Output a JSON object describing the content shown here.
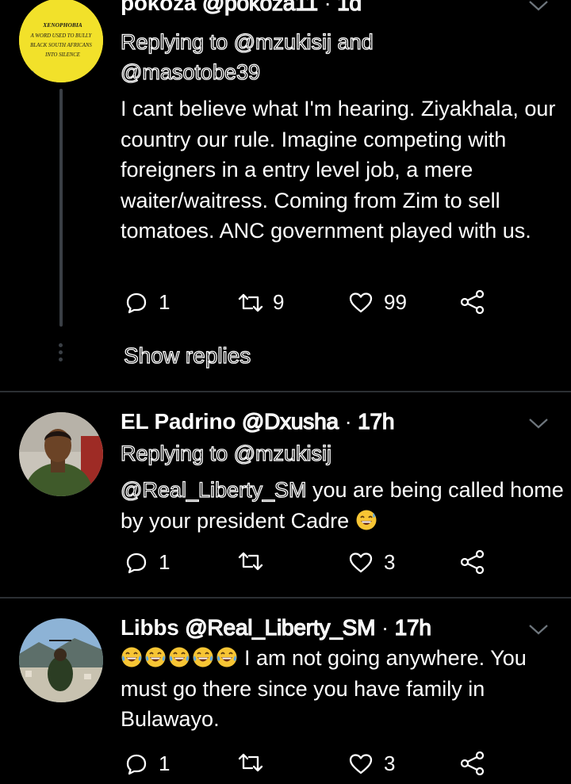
{
  "tweets": [
    {
      "author_name": "pokoza",
      "handle": "@pokoza11",
      "time": "1d",
      "replying_to_prefix": "Replying to",
      "replying_to_1": "@mzukisij",
      "replying_to_and": "and",
      "replying_to_2": "@masotobe39",
      "avatar_text": "XENOPHOBIA A WORD USED TO BULLY BLACK SOUTH AFRICANS INTO SILENCE",
      "body": "I cant believe what I'm hearing. Ziyakhala, our country our rule. Imagine competing with foreigners in a entry level job, a mere waiter/waitress. Coming from Zim to sell tomatoes. ANC government played with us.",
      "replies": "1",
      "retweets": "9",
      "likes": "99",
      "show_replies": "Show replies"
    },
    {
      "author_name": "EL Padrino",
      "handle": "@Dxusha",
      "time": "17h",
      "replying_to_prefix": "Replying to",
      "replying_to_1": "@mzukisij",
      "mention": "@Real_Liberty_SM",
      "body": " you are being called home by your president Cadre",
      "replies": "1",
      "retweets": "",
      "likes": "3"
    },
    {
      "author_name": "Libbs",
      "handle": "@Real_Liberty_SM",
      "time": "17h",
      "body": "I am not going anywhere. You must go there since you have family in Bulawayo.",
      "replies": "1",
      "retweets": "",
      "likes": "3"
    }
  ],
  "separator": "·",
  "colors": {
    "background": "#000000",
    "text": "#ffffff",
    "icon": "#ffffff",
    "divider": "#2b2f33"
  },
  "icons": [
    "reply-icon",
    "retweet-icon",
    "like-icon",
    "share-icon",
    "chevron-down-icon",
    "laughing-emoji",
    "sweat-smile-emoji"
  ]
}
